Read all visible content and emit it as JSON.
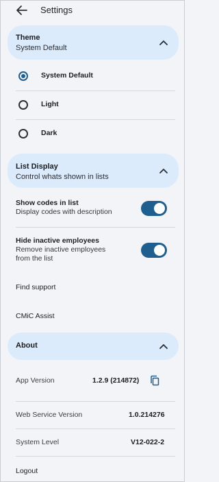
{
  "header": {
    "title": "Settings"
  },
  "theme": {
    "title": "Theme",
    "subtitle": "System Default",
    "options": [
      "System Default",
      "Light",
      "Dark"
    ],
    "selected": "System Default"
  },
  "list_display": {
    "title": "List Display",
    "subtitle": "Control whats shown in lists",
    "toggles": [
      {
        "title": "Show codes in list",
        "desc_lines": [
          "Display codes with description"
        ],
        "on": true
      },
      {
        "title": "Hide inactive employees",
        "desc_lines": [
          "Remove inactive employees",
          "from the list"
        ],
        "on": true
      }
    ]
  },
  "links": {
    "find_support": "Find support",
    "cmic_assist": "CMiC Assist"
  },
  "about": {
    "title": "About",
    "rows": [
      {
        "label": "App Version",
        "value": "1.2.9 (214872)"
      },
      {
        "label": "Web Service Version",
        "value": "1.0.214276"
      },
      {
        "label": "System Level",
        "value": "V12-022-2"
      }
    ]
  },
  "logout": "Logout",
  "colors": {
    "accent": "#1f5f8f",
    "section_bg": "#dcebfb",
    "page_bg": "#f3f4f7"
  }
}
